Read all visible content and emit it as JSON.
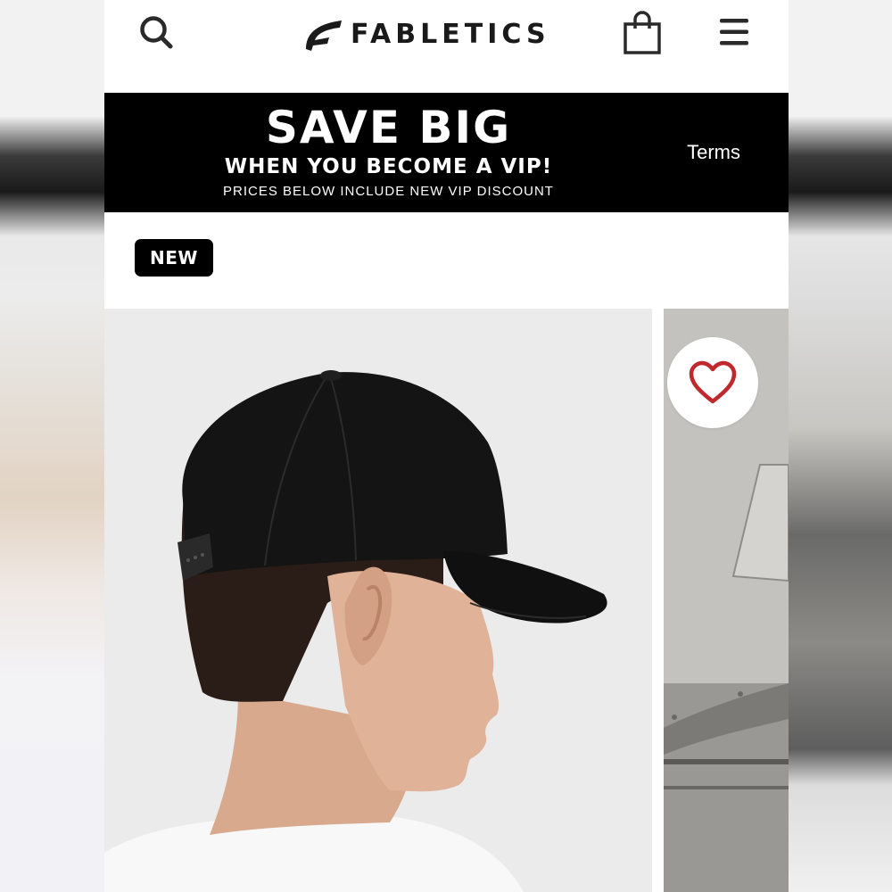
{
  "header": {
    "brand": "FABLETICS",
    "icons": {
      "search": "search-icon",
      "bag": "shopping-bag-icon",
      "menu": "hamburger-menu-icon"
    }
  },
  "promo_banner": {
    "headline": "SAVE BIG",
    "subheadline": "WHEN YOU BECOME A VIP!",
    "fine_print": "PRICES BELOW INCLUDE NEW VIP DISCOUNT",
    "terms_link": "Terms"
  },
  "product": {
    "badge": "NEW",
    "favorite_icon": "heart-icon",
    "image_subject": "man wearing black baseball cap, side view"
  },
  "colors": {
    "brand_black": "#000000",
    "heart_red": "#c0282d",
    "background": "#ffffff"
  }
}
